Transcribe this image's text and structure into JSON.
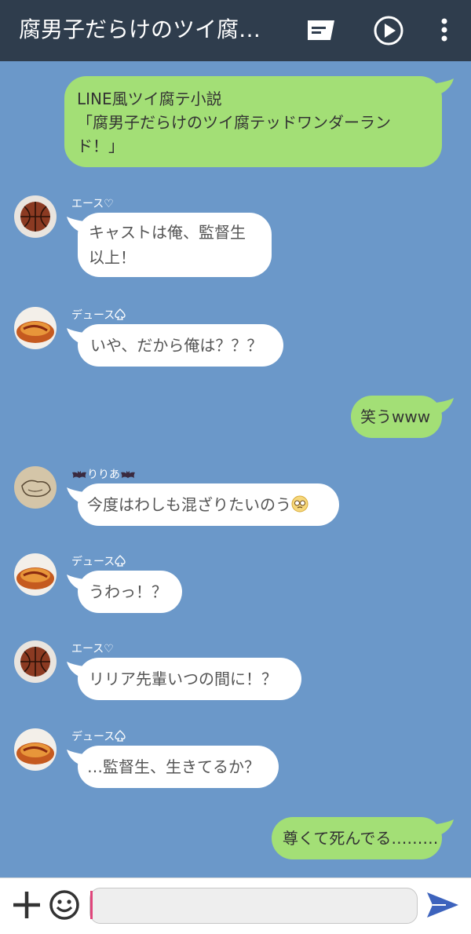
{
  "header": {
    "title": "腐男子だらけのツイ腐…",
    "icons": [
      "chat-menu-icon",
      "play-icon",
      "more-vertical-icon"
    ],
    "background": "#2f3d4d"
  },
  "colors": {
    "chat_background": "#6b98c9",
    "my_bubble": "#a3df76",
    "their_bubble": "#ffffff",
    "caret": "#e0457b",
    "send": "#3d63bd"
  },
  "messages": [
    {
      "side": "me",
      "lines": [
        "LINE風ツイ腐テ小説",
        "「腐男子だらけのツイ腐テッドワンダーラン",
        "ド！」"
      ]
    },
    {
      "side": "them",
      "sender": "エース♡",
      "avatar": "basketball",
      "lines": [
        "キャストは俺、監督生",
        "以上！"
      ]
    },
    {
      "side": "them",
      "sender": "デュース",
      "sender_icon": "spade-icon",
      "avatar": "omurice",
      "lines": [
        "いや、だから俺は？？？"
      ]
    },
    {
      "side": "me",
      "lines": [
        "笑うwww"
      ]
    },
    {
      "side": "them",
      "sender_prefix_icon": "bat-icon",
      "sender": "りりあ",
      "sender_icon": "bat-icon",
      "avatar": "sketch",
      "lines": [
        "今度はわしも混ざりたいのう"
      ],
      "emoji": "pleading-face-icon"
    },
    {
      "side": "them",
      "sender": "デュース",
      "sender_icon": "spade-icon",
      "avatar": "omurice",
      "lines": [
        "うわっ！？"
      ]
    },
    {
      "side": "them",
      "sender": "エース♡",
      "avatar": "basketball",
      "lines": [
        "リリア先輩いつの間に！？"
      ]
    },
    {
      "side": "them",
      "sender": "デュース",
      "sender_icon": "spade-icon",
      "avatar": "omurice",
      "lines": [
        "…監督生、生きてるか？"
      ]
    },
    {
      "side": "me",
      "lines": [
        "尊くて死んでる………"
      ]
    }
  ],
  "input": {
    "value": "",
    "icons": [
      "plus-icon",
      "smiley-icon",
      "send-icon"
    ]
  }
}
